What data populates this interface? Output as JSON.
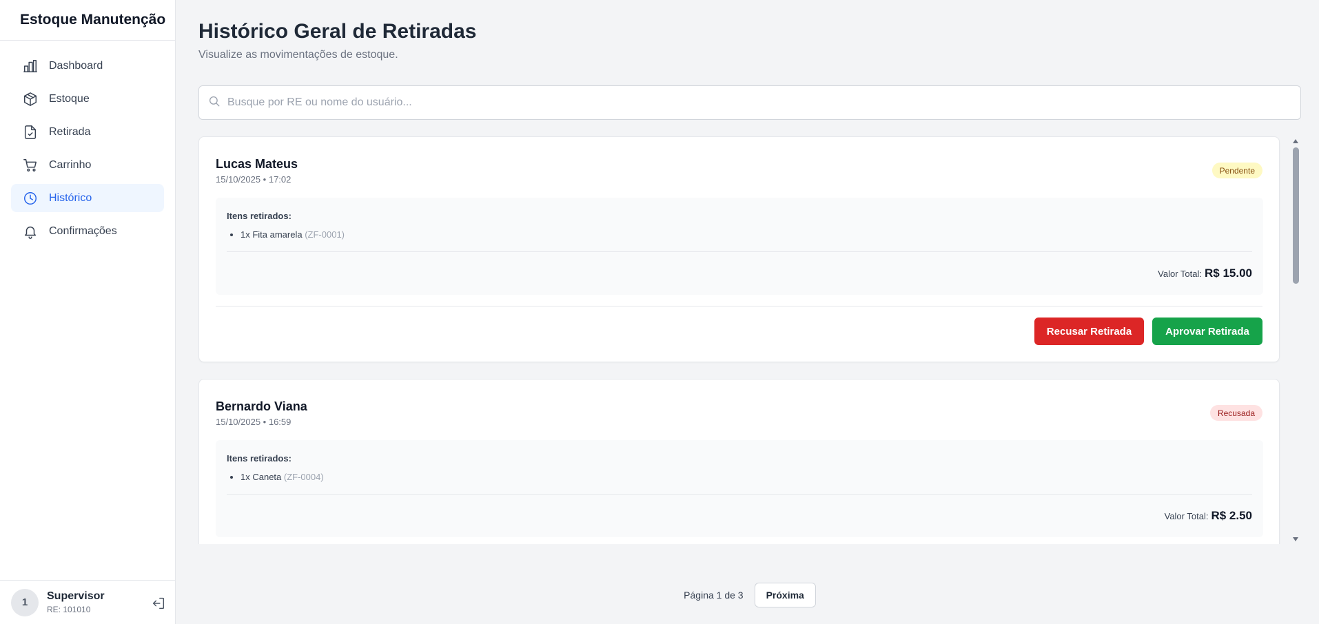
{
  "sidebar": {
    "brand": "Estoque Manutenção",
    "items": [
      {
        "label": "Dashboard",
        "icon": "bar-chart-icon"
      },
      {
        "label": "Estoque",
        "icon": "box-icon"
      },
      {
        "label": "Retirada",
        "icon": "file-check-icon"
      },
      {
        "label": "Carrinho",
        "icon": "cart-icon"
      },
      {
        "label": "Histórico",
        "icon": "clock-icon",
        "active": true
      },
      {
        "label": "Confirmações",
        "icon": "bell-icon"
      }
    ],
    "user": {
      "initial": "1",
      "name": "Supervisor",
      "re": "RE: 101010"
    }
  },
  "header": {
    "title": "Histórico Geral de Retiradas",
    "subtitle": "Visualize as movimentações de estoque."
  },
  "search": {
    "placeholder": "Busque por RE ou nome do usuário...",
    "value": ""
  },
  "cards": [
    {
      "name": "Lucas Mateus",
      "date": "15/10/2025 • 17:02",
      "status": "Pendente",
      "items_label": "Itens retirados:",
      "items": [
        {
          "text": "1x Fita amarela",
          "code": "(ZF-0001)"
        }
      ],
      "total_label": "Valor Total:",
      "total": "R$ 15.00",
      "refuse_label": "Recusar Retirada",
      "approve_label": "Aprovar Retirada"
    },
    {
      "name": "Bernardo Viana",
      "date": "15/10/2025 • 16:59",
      "status": "Recusada",
      "items_label": "Itens retirados:",
      "items": [
        {
          "text": "1x Caneta",
          "code": "(ZF-0004)"
        }
      ],
      "total_label": "Valor Total:",
      "total": "R$ 2.50"
    }
  ],
  "pagination": {
    "info": "Página 1 de 3",
    "next_label": "Próxima"
  },
  "colors": {
    "accent": "#2563eb",
    "approve": "#16a34a",
    "refuse": "#dc2626",
    "pending_bg": "#fef9c3",
    "refused_bg": "#fee2e2"
  }
}
